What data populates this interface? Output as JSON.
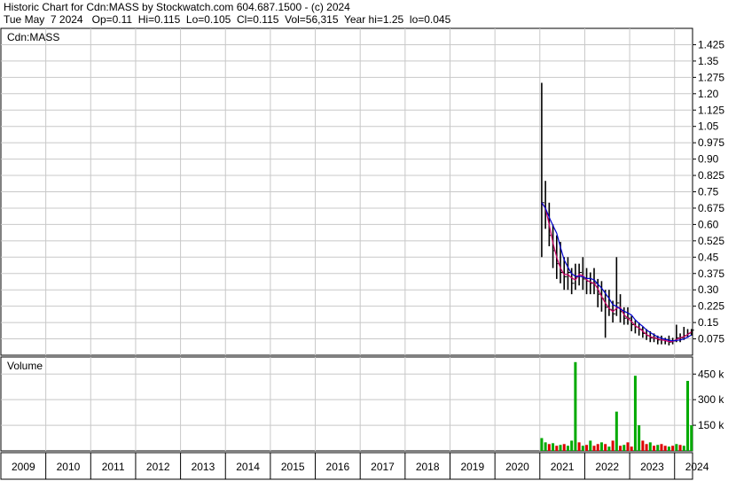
{
  "header": {
    "line1": "Historic Chart for Cdn:MASS by Stockwatch.com 604.687.1500 - (c) 2024",
    "line2": "Tue May  7 2024   Op=0.11  Hi=0.115  Lo=0.105  Cl=0.115  Vol=56,315  Year hi=1.25  lo=0.045"
  },
  "chart_data": [
    {
      "type": "line",
      "title": "Cdn:MASS",
      "ylim": [
        0,
        1.5
      ],
      "y_ticks": [
        "1.425",
        "1.35",
        "1.275",
        "1.20",
        "1.125",
        "1.05",
        "0.975",
        "0.90",
        "0.825",
        "0.75",
        "0.675",
        "0.60",
        "0.525",
        "0.45",
        "0.375",
        "0.30",
        "0.225",
        "0.15",
        "0.075"
      ],
      "x_ticks": [
        "2009",
        "2010",
        "2011",
        "2012",
        "2013",
        "2014",
        "2015",
        "2016",
        "2017",
        "2018",
        "2019",
        "2020",
        "2021",
        "2022",
        "2023",
        "2024"
      ],
      "x": [
        "2021-01",
        "2021-02",
        "2021-03",
        "2021-04",
        "2021-05",
        "2021-06",
        "2021-07",
        "2021-08",
        "2021-09",
        "2021-10",
        "2021-11",
        "2021-12",
        "2022-01",
        "2022-02",
        "2022-03",
        "2022-04",
        "2022-05",
        "2022-06",
        "2022-07",
        "2022-08",
        "2022-09",
        "2022-10",
        "2022-11",
        "2022-12",
        "2023-01",
        "2023-02",
        "2023-03",
        "2023-04",
        "2023-05",
        "2023-06",
        "2023-07",
        "2023-08",
        "2023-09",
        "2023-10",
        "2023-11",
        "2023-12",
        "2024-01",
        "2024-02",
        "2024-03",
        "2024-04",
        "2024-05"
      ],
      "high": [
        1.25,
        0.8,
        0.7,
        0.6,
        0.55,
        0.52,
        0.45,
        0.45,
        0.4,
        0.42,
        0.42,
        0.45,
        0.4,
        0.38,
        0.4,
        0.35,
        0.34,
        0.3,
        0.3,
        0.25,
        0.45,
        0.28,
        0.22,
        0.22,
        0.18,
        0.16,
        0.15,
        0.13,
        0.12,
        0.11,
        0.1,
        0.09,
        0.09,
        0.08,
        0.09,
        0.08,
        0.14,
        0.1,
        0.13,
        0.12,
        0.12
      ],
      "low": [
        0.45,
        0.58,
        0.5,
        0.4,
        0.35,
        0.33,
        0.3,
        0.3,
        0.28,
        0.3,
        0.32,
        0.3,
        0.28,
        0.28,
        0.28,
        0.22,
        0.2,
        0.08,
        0.18,
        0.15,
        0.18,
        0.15,
        0.14,
        0.14,
        0.11,
        0.1,
        0.09,
        0.08,
        0.07,
        0.06,
        0.06,
        0.05,
        0.05,
        0.05,
        0.045,
        0.05,
        0.06,
        0.06,
        0.07,
        0.08,
        0.09
      ],
      "close": [
        0.7,
        0.65,
        0.55,
        0.48,
        0.42,
        0.38,
        0.36,
        0.38,
        0.33,
        0.36,
        0.38,
        0.35,
        0.34,
        0.33,
        0.33,
        0.28,
        0.26,
        0.22,
        0.21,
        0.19,
        0.24,
        0.2,
        0.17,
        0.17,
        0.14,
        0.13,
        0.12,
        0.1,
        0.09,
        0.08,
        0.08,
        0.07,
        0.07,
        0.065,
        0.06,
        0.065,
        0.08,
        0.08,
        0.09,
        0.1,
        0.115
      ],
      "colors": {
        "price": "#000000",
        "ma_short": "#cc0066",
        "ma_long": "#0000cc",
        "grid": "#c8c8c8"
      }
    },
    {
      "type": "bar",
      "title": "Volume",
      "ylim": [
        0,
        550000
      ],
      "y_ticks": [
        "450 k",
        "300 k",
        "150 k"
      ],
      "x": [
        "2021-01",
        "2021-02",
        "2021-03",
        "2021-04",
        "2021-05",
        "2021-06",
        "2021-07",
        "2021-08",
        "2021-09",
        "2021-10",
        "2021-11",
        "2021-12",
        "2022-01",
        "2022-02",
        "2022-03",
        "2022-04",
        "2022-05",
        "2022-06",
        "2022-07",
        "2022-08",
        "2022-09",
        "2022-10",
        "2022-11",
        "2022-12",
        "2023-01",
        "2023-02",
        "2023-03",
        "2023-04",
        "2023-05",
        "2023-06",
        "2023-07",
        "2023-08",
        "2023-09",
        "2023-10",
        "2023-11",
        "2023-12",
        "2024-01",
        "2024-02",
        "2024-03",
        "2024-04",
        "2024-05"
      ],
      "values": [
        75000,
        50000,
        40000,
        45000,
        30000,
        35000,
        40000,
        30000,
        60000,
        520000,
        50000,
        30000,
        35000,
        60000,
        30000,
        40000,
        50000,
        40000,
        25000,
        60000,
        230000,
        30000,
        35000,
        50000,
        25000,
        440000,
        150000,
        60000,
        40000,
        50000,
        30000,
        35000,
        40000,
        30000,
        25000,
        30000,
        40000,
        35000,
        30000,
        410000,
        150000
      ],
      "up": [
        true,
        true,
        false,
        true,
        false,
        true,
        false,
        true,
        true,
        true,
        false,
        true,
        false,
        true,
        false,
        false,
        true,
        false,
        true,
        false,
        true,
        false,
        true,
        false,
        false,
        true,
        true,
        false,
        false,
        true,
        false,
        true,
        false,
        false,
        true,
        false,
        true,
        false,
        true,
        true,
        true
      ],
      "colors": {
        "up": "#00aa00",
        "down": "#dd0000"
      }
    }
  ]
}
